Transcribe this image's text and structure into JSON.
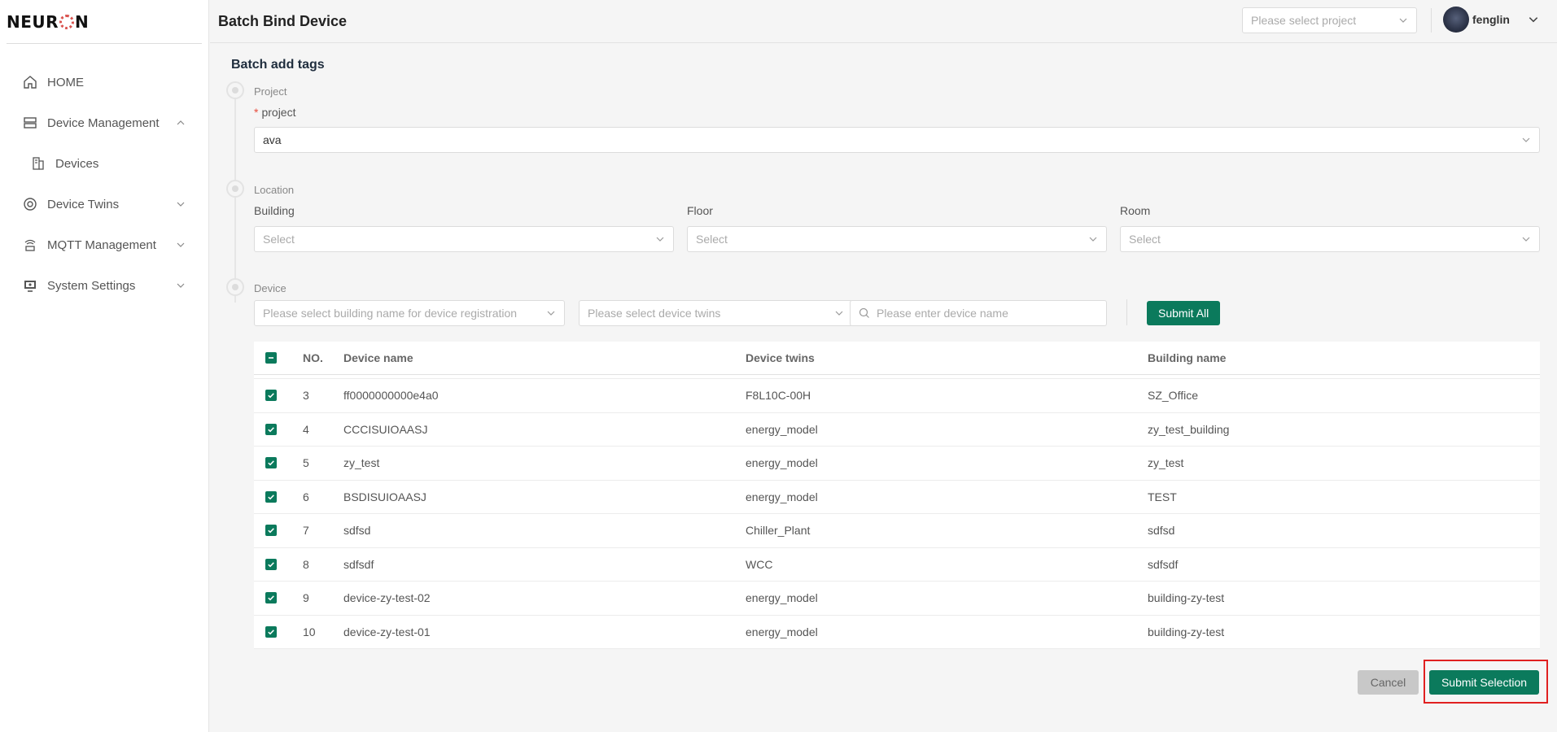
{
  "brand": {
    "logo_text_left": "NEUR",
    "logo_text_right": "N"
  },
  "sidebar": {
    "items": [
      {
        "label": "HOME",
        "icon": "home-icon"
      },
      {
        "label": "Device Management",
        "icon": "server-icon",
        "expanded": true
      },
      {
        "label": "Devices",
        "icon": "devices-icon"
      },
      {
        "label": "Device Twins",
        "icon": "twins-icon"
      },
      {
        "label": "MQTT Management",
        "icon": "mqtt-icon"
      },
      {
        "label": "System Settings",
        "icon": "monitor-icon"
      }
    ]
  },
  "header": {
    "title": "Batch Bind Device",
    "project_placeholder": "Please select project",
    "username": "fenglin"
  },
  "form": {
    "section_title": "Batch add tags",
    "step_project": "Project",
    "project_label": "project",
    "project_value": "ava",
    "step_location": "Location",
    "building_label": "Building",
    "floor_label": "Floor",
    "room_label": "Room",
    "select_placeholder": "Select",
    "step_device": "Device",
    "building_filter_placeholder": "Please select building name for device registration",
    "twins_filter_placeholder": "Please select device twins",
    "device_search_placeholder": "Please enter device name",
    "submit_all_label": "Submit All"
  },
  "table": {
    "headers": {
      "no": "NO.",
      "name": "Device name",
      "twins": "Device twins",
      "building": "Building name"
    },
    "rows": [
      {
        "no": "3",
        "name": "ff0000000000e4a0",
        "twins": "F8L10C-00H",
        "building": "SZ_Office",
        "checked": true
      },
      {
        "no": "4",
        "name": "CCCISUIOAASJ",
        "twins": "energy_model",
        "building": "zy_test_building",
        "checked": true
      },
      {
        "no": "5",
        "name": "zy_test",
        "twins": "energy_model",
        "building": "zy_test",
        "checked": true
      },
      {
        "no": "6",
        "name": "BSDISUIOAASJ",
        "twins": "energy_model",
        "building": "TEST",
        "checked": true
      },
      {
        "no": "7",
        "name": "sdfsd",
        "twins": "Chiller_Plant",
        "building": "sdfsd",
        "checked": true
      },
      {
        "no": "8",
        "name": "sdfsdf",
        "twins": "WCC",
        "building": "sdfsdf",
        "checked": true
      },
      {
        "no": "9",
        "name": "device-zy-test-02",
        "twins": "energy_model",
        "building": "building-zy-test",
        "checked": true
      },
      {
        "no": "10",
        "name": "device-zy-test-01",
        "twins": "energy_model",
        "building": "building-zy-test",
        "checked": true
      }
    ]
  },
  "footer": {
    "cancel_label": "Cancel",
    "submit_label": "Submit Selection"
  },
  "colors": {
    "primary": "#0b7a5c",
    "highlight": "#e02020"
  }
}
